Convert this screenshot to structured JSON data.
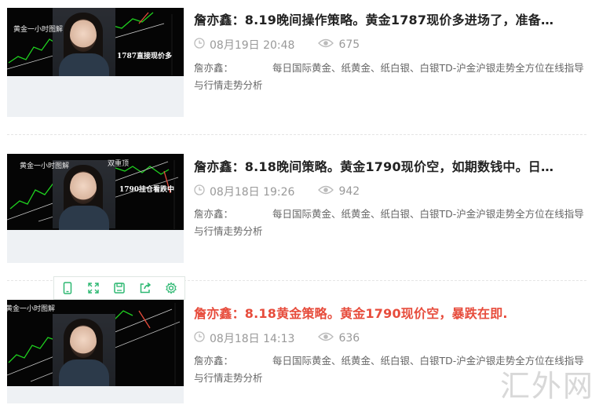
{
  "articles": [
    {
      "title": "詹亦鑫：8.19晚间操作策略。黄金1787现价多进场了，准备…",
      "date": "08月19日 20:48",
      "views": "675",
      "summary_author": "詹亦鑫：",
      "summary_text": "每日国际黄金、纸黄金、纸白银、白银TD-沪金沪银走势全方位在线指导与行情走势分析",
      "thumb_title": "黄金一小时图解",
      "thumb_note": "1787直接现价多",
      "highlight": false
    },
    {
      "title": "詹亦鑫：8.18晚间策略。黄金1790现价空，如期数钱中。日…",
      "date": "08月18日 19:26",
      "views": "942",
      "summary_author": "詹亦鑫：",
      "summary_text": "每日国际黄金、纸黄金、纸白银、白银TD-沪金沪银走势全方位在线指导与行情走势分析",
      "thumb_title": "黄金一小时图解",
      "thumb_title2": "双重顶",
      "thumb_note": "1790挂仓看跌中",
      "highlight": false
    },
    {
      "title": "詹亦鑫：8.18黄金策略。黄金1790现价空，暴跌在即.",
      "date": "08月18日 14:13",
      "views": "636",
      "summary_author": "詹亦鑫：",
      "summary_text": "每日国际黄金、纸黄金、纸白银、白银TD-沪金沪银走势全方位在线指导与行情走势分析",
      "thumb_title": "黄金一小时图解",
      "highlight": true
    }
  ],
  "toolbar_icons": [
    "phone-icon",
    "expand-icon",
    "save-icon",
    "share-icon",
    "gear-icon"
  ],
  "watermark": "汇外网",
  "colors": {
    "highlight": "#e74c3c",
    "toolbar_green": "#2eb872",
    "chart_green": "#1fd01f"
  }
}
